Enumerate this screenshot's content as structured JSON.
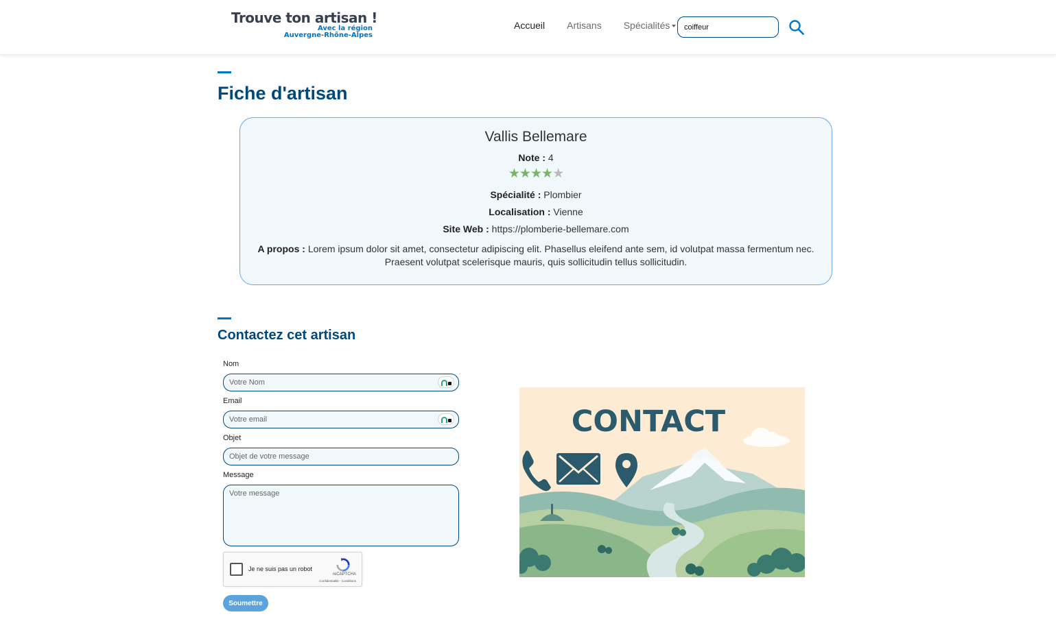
{
  "header": {
    "logo_title": "Trouve ton artisan !",
    "logo_sub1": "Avec la région",
    "logo_sub2": "Auvergne-Rhône-Alpes",
    "nav": [
      "Accueil",
      "Artisans",
      "Spécialités"
    ],
    "search_value": "coiffeur",
    "search_icon": "search-icon"
  },
  "page_title": "Fiche d'artisan",
  "artisan": {
    "name": "Vallis Bellemare",
    "note_label": "Note :",
    "note_value": "4",
    "rating": 4,
    "rating_max": 5,
    "specialite_label": "Spécialité :",
    "specialite_value": "Plombier",
    "localisation_label": "Localisation :",
    "localisation_value": "Vienne",
    "site_label": "Site Web :",
    "site_value": "https://plomberie-bellemare.com",
    "apropos_label": "A propos :",
    "apropos_value": "Lorem ipsum dolor sit amet, consectetur adipiscing elit. Phasellus eleifend ante sem, id volutpat massa fermentum nec. Praesent volutpat scelerisque mauris, quis sollicitudin tellus sollicitudin."
  },
  "contact": {
    "title": "Contactez cet artisan",
    "nom_label": "Nom",
    "nom_placeholder": "Votre Nom",
    "email_label": "Email",
    "email_placeholder": "Votre email",
    "objet_label": "Objet",
    "objet_placeholder": "Objet de votre message",
    "message_label": "Message",
    "message_placeholder": "Votre message",
    "captcha_text": "Je ne suis pas un robot",
    "captcha_brand": "reCAPTCHA",
    "captcha_links": "Confidentialité - Conditions",
    "submit_label": "Soumettre"
  },
  "illustration": {
    "title": "CONTACT",
    "icons": [
      "phone-icon",
      "envelope-icon",
      "location-pin-icon"
    ]
  },
  "colors": {
    "primary": "#00497c",
    "accent": "#0074c7",
    "card_bg": "#f1f8fb",
    "star": "#7cb36a"
  }
}
